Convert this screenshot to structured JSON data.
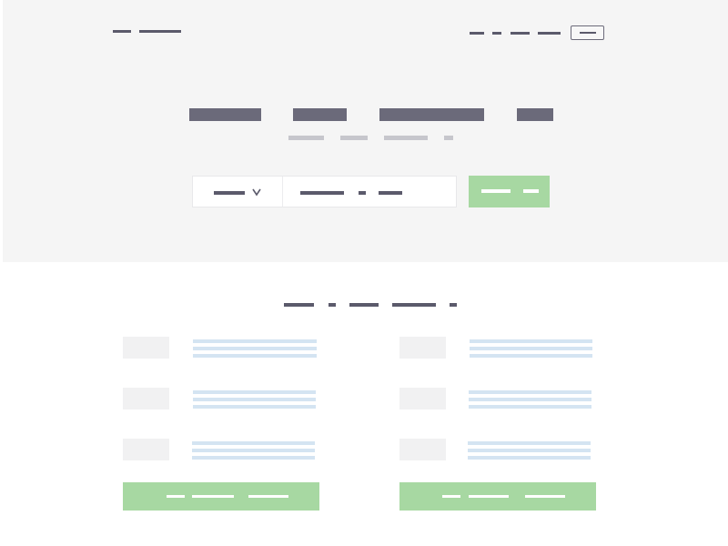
{
  "colors": {
    "hero_background": "#f5f5f5",
    "text_dark": "#5b5a6b",
    "headline": "#6b6a7a",
    "subtitle": "#c6c6cc",
    "accent_green": "#a7d8a2",
    "link_blue": "#d4e4f2",
    "thumbnail": "#f1f1f2"
  },
  "header": {
    "logo": "",
    "nav_items": [
      "",
      "",
      "",
      ""
    ],
    "nav_button_label": ""
  },
  "hero": {
    "headline": "",
    "subtitle": "",
    "search": {
      "select_value": "",
      "select_icon": "chevron-down-icon",
      "query_value": "",
      "button_label": ""
    }
  },
  "section": {
    "title": "",
    "columns": [
      {
        "items": [
          {
            "text": ""
          },
          {
            "text": ""
          },
          {
            "text": ""
          }
        ],
        "cta_label": ""
      },
      {
        "items": [
          {
            "text": ""
          },
          {
            "text": ""
          },
          {
            "text": ""
          }
        ],
        "cta_label": ""
      }
    ]
  }
}
